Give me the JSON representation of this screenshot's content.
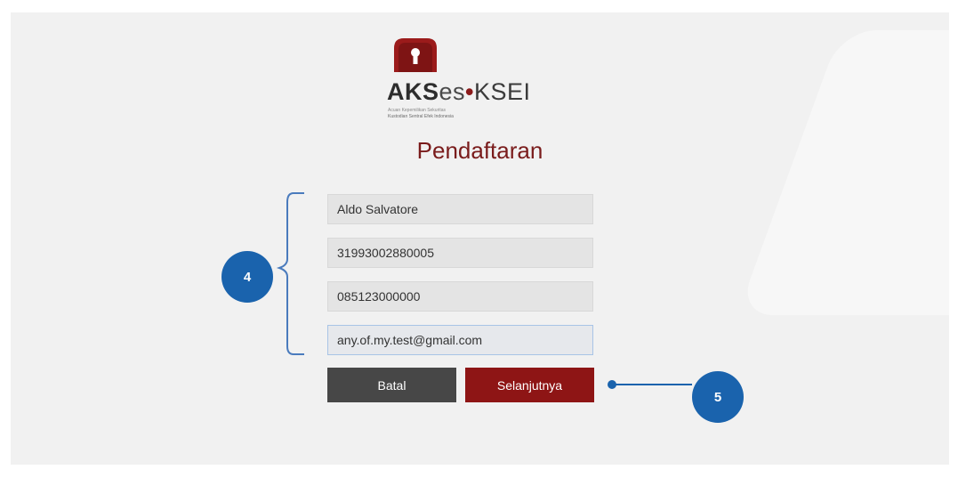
{
  "logo": {
    "brand_bold": "AKS",
    "brand_light": "es",
    "brand_sep": "•",
    "brand_suffix": "KSEI",
    "tagline": "Acuan Kepemilikan Sekuritas",
    "company": "Kustodian Sentral Efek Indonesia"
  },
  "page_title": "Pendaftaran",
  "form": {
    "name": "Aldo Salvatore",
    "id_number": "31993002880005",
    "phone": "085123000000",
    "email": "any.of.my.test@gmail.com"
  },
  "buttons": {
    "cancel": "Batal",
    "next": "Selanjutnya"
  },
  "annotations": {
    "step_4": "4",
    "step_5": "5"
  },
  "colors": {
    "brand": "#8e1515",
    "title": "#7a1c1c",
    "callout": "#1a63ad",
    "cancel_button": "#474747"
  },
  "icons": {
    "logo": "lock-icon"
  }
}
